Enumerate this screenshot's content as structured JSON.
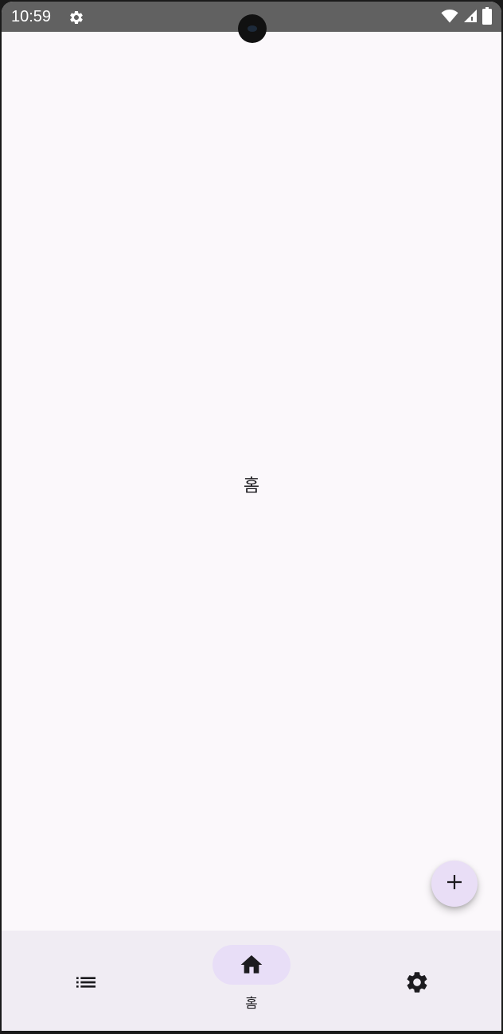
{
  "status_bar": {
    "time": "10:59",
    "icons": [
      "gear-icon",
      "wifi-icon",
      "cellular-signal-icon",
      "battery-icon"
    ]
  },
  "main": {
    "title": "홈"
  },
  "fab": {
    "icon": "plus-icon"
  },
  "bottom_nav": {
    "items": [
      {
        "id": "list",
        "icon": "list-icon",
        "label": "",
        "selected": false
      },
      {
        "id": "home",
        "icon": "home-icon",
        "label": "홈",
        "selected": true
      },
      {
        "id": "settings",
        "icon": "settings-icon",
        "label": "",
        "selected": false
      }
    ]
  },
  "colors": {
    "status_bar": "#616161",
    "background": "#fbf8fb",
    "nav_background": "#f0ecf3",
    "selected_pill": "#e8def7",
    "fab_background": "#e9def6",
    "icon_color": "#1c1b1f"
  }
}
